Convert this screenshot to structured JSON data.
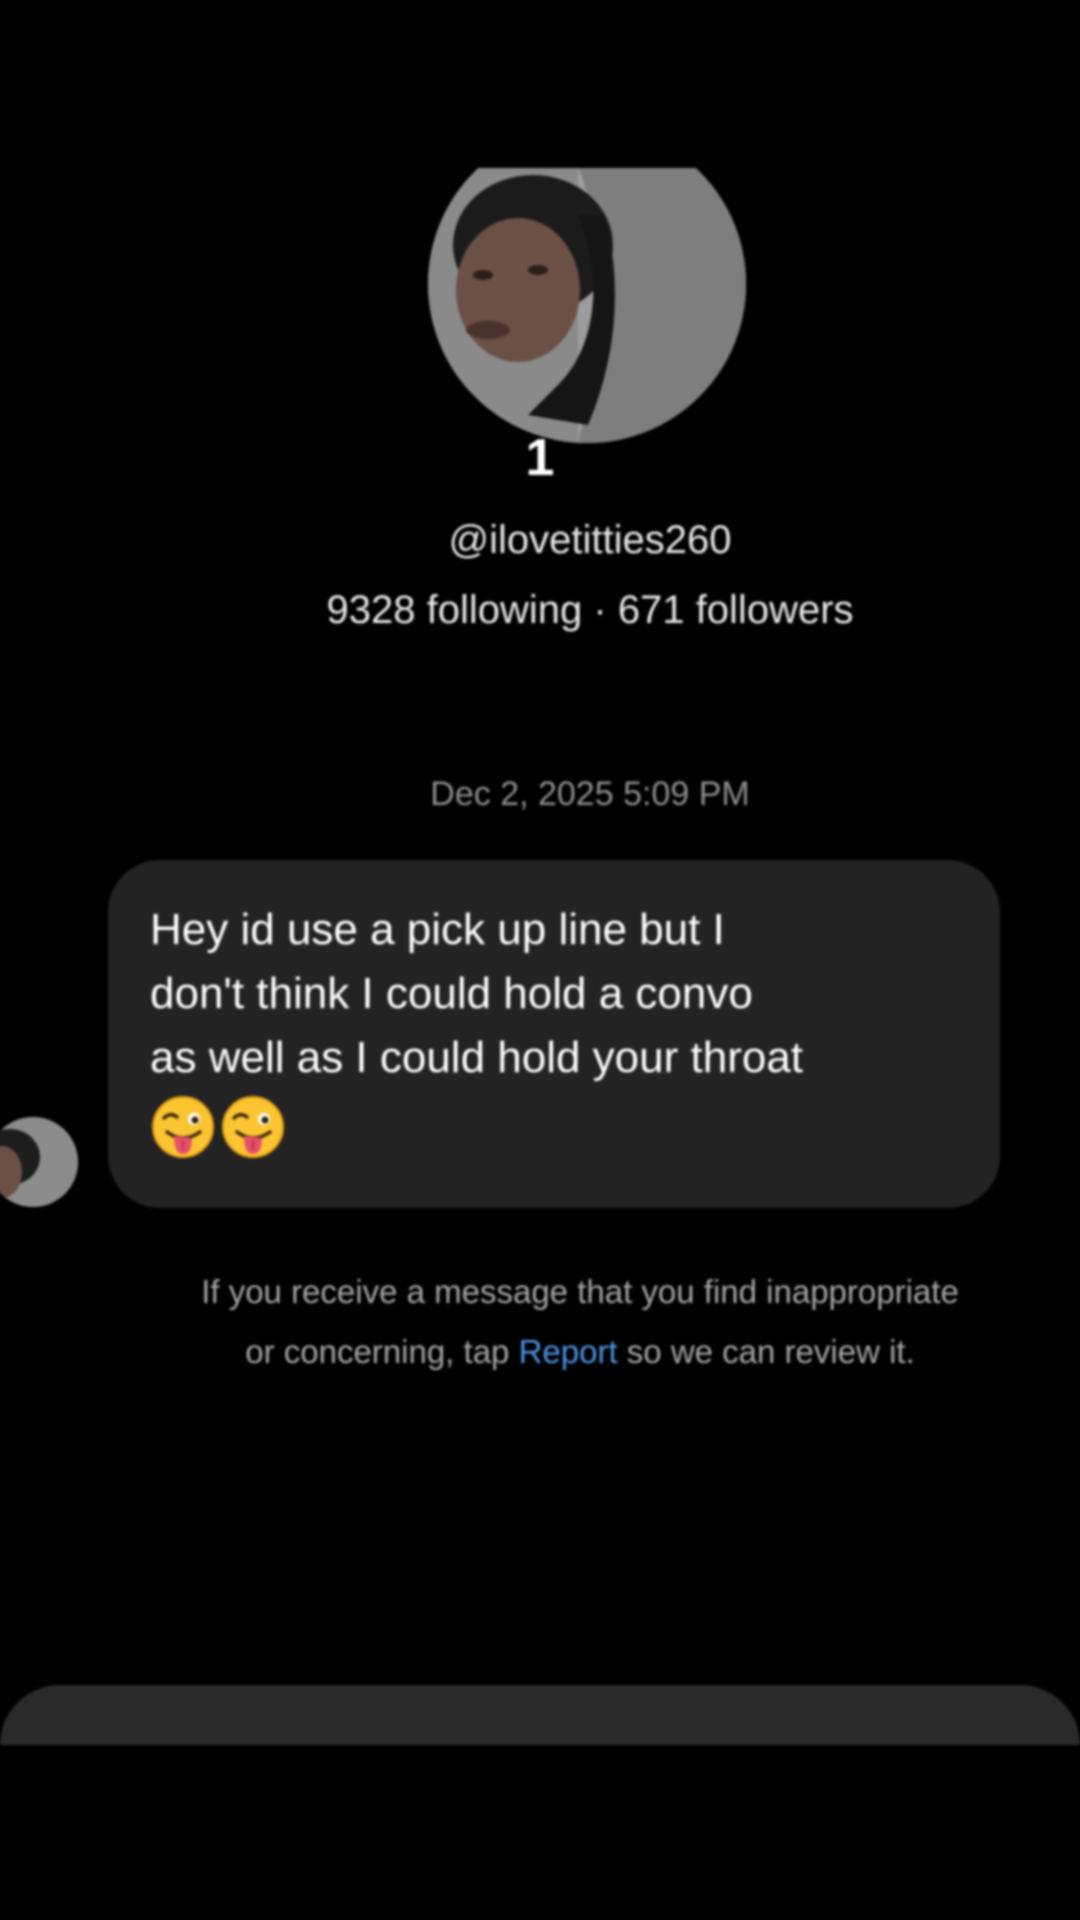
{
  "profile": {
    "display_name": "1",
    "username": "@ilovetitties260",
    "following_count": "9328",
    "following_label": "following",
    "separator": "·",
    "followers_count": "671",
    "followers_label": "followers"
  },
  "conversation": {
    "timestamp": "Dec 2, 2025 5:09 PM",
    "message": {
      "text": "Hey id use a pick up line but I\ndon't think I could hold a convo\nas well as I could hold your throat",
      "emoji": [
        "winking-face-with-tongue",
        "winking-face-with-tongue"
      ]
    }
  },
  "safety_notice": {
    "line1": "If you receive a message that you find inappropriate",
    "line2_before": "or concerning, tap ",
    "link": "Report",
    "line2_after": " so we can review it."
  },
  "colors": {
    "background": "#000000",
    "bubble": "#232323",
    "link": "#4d93e6",
    "muted_text": "#a5a5a5"
  }
}
